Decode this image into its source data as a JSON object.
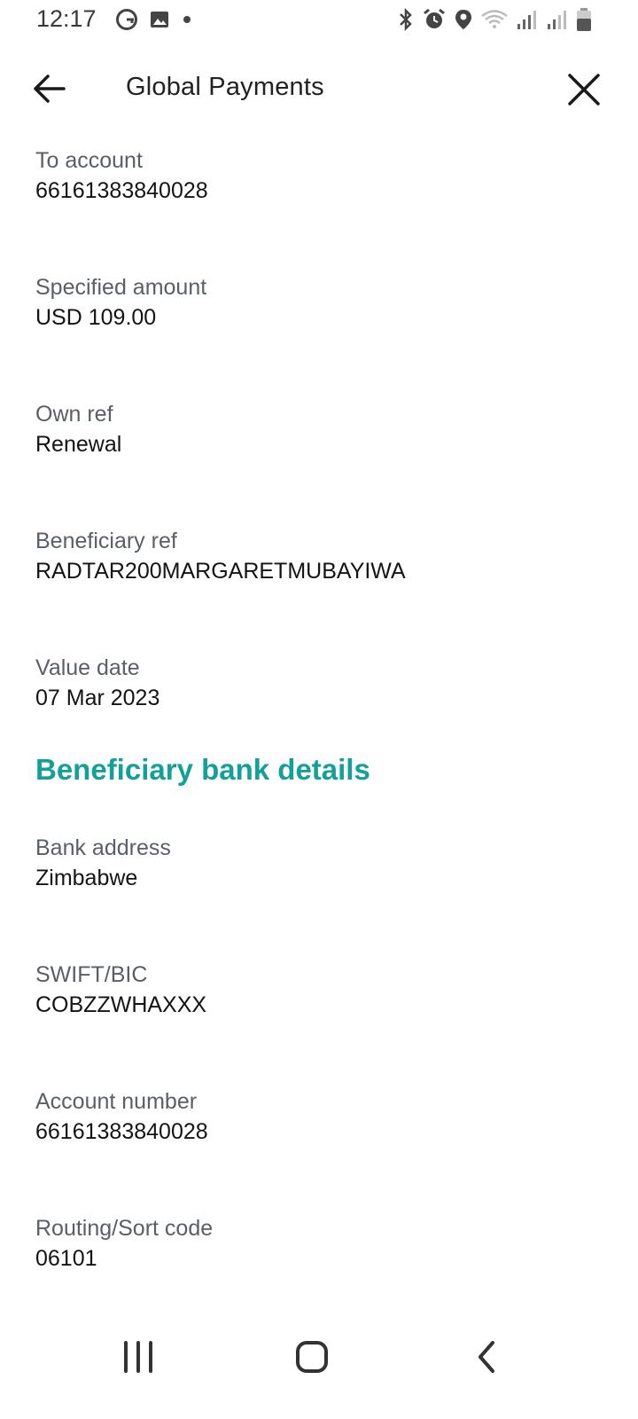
{
  "status_bar": {
    "time": "12:17",
    "left_icons": [
      "g-icon",
      "gallery-icon",
      "dot-icon"
    ],
    "right_icons": [
      "bluetooth-icon",
      "alarm-icon",
      "location-icon",
      "wifi-icon",
      "signal-icon",
      "signal-icon-2",
      "battery-icon"
    ]
  },
  "header": {
    "title": "Global Payments"
  },
  "transfer": [
    {
      "label": "To account",
      "value": "66161383840028"
    },
    {
      "label": "Specified amount",
      "value": "USD 109.00"
    },
    {
      "label": "Own ref",
      "value": "Renewal"
    },
    {
      "label": "Beneficiary ref",
      "value": "RADTAR200MARGARETMUBAYIWA"
    },
    {
      "label": "Value date",
      "value": "07 Mar 2023"
    }
  ],
  "beneficiary_bank": {
    "heading": "Beneficiary bank details",
    "fields": [
      {
        "label": "Bank address",
        "value": "Zimbabwe"
      },
      {
        "label": "SWIFT/BIC",
        "value": "COBZZWHAXXX"
      },
      {
        "label": "Account number",
        "value": "66161383840028"
      },
      {
        "label": "Routing/Sort code",
        "value": "06101"
      }
    ]
  },
  "colors": {
    "accent": "#14a09a",
    "label": "#5a5f66",
    "value": "#141414"
  }
}
